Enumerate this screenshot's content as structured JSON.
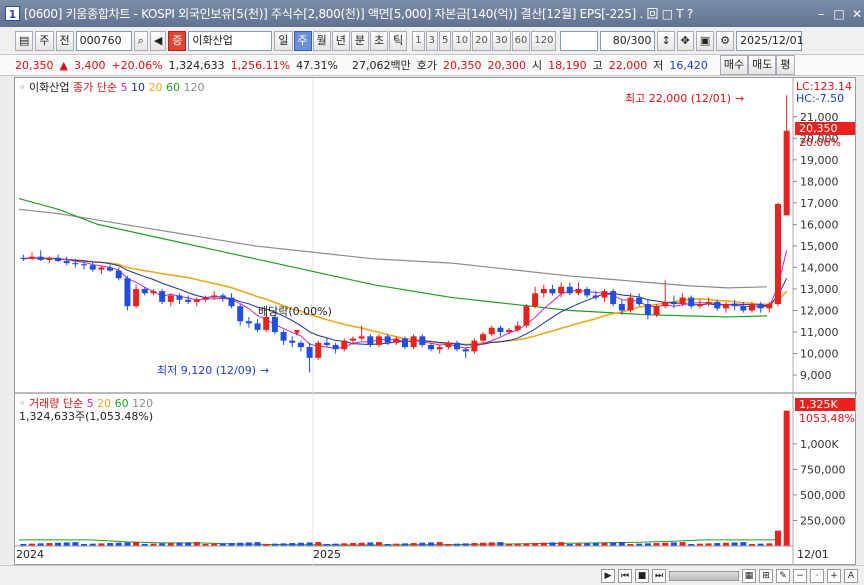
{
  "window": {
    "number": "1",
    "title": "[0600] 키움종합차트 - KOSPI 외국인보유[5(천)] 주식수[2,800(천)] 액면[5,000] 자본금[140(억)] 결산[12월] EPS[-225] . 回 □ T ?"
  },
  "toolbar": {
    "period_type": "주",
    "prev_label": "전",
    "code": "000760",
    "badge": "증",
    "stock_name": "이화산업",
    "tabs": [
      "일",
      "주",
      "월",
      "년",
      "분",
      "초",
      "틱"
    ],
    "selected_tab": "주",
    "intervals": [
      "1",
      "3",
      "5",
      "10",
      "20",
      "30",
      "60",
      "120"
    ],
    "count": "80/300",
    "date": "2025/12/01"
  },
  "quote": {
    "price": "20,350",
    "arrow": "▲",
    "change": "3,400",
    "rate": "+20.06%",
    "volume": "1,324,633",
    "vol_rate": "1,256.11%",
    "turnover": "47.31%",
    "amount": "27,062백만",
    "ask_label": "호가",
    "ask": "20,350",
    "bid": "20,300",
    "open_label": "시",
    "open": "18,190",
    "high_label": "고",
    "high": "22,000",
    "low_label": "저",
    "low": "16,420",
    "sell_label": "매수",
    "buy_label": "매도",
    "flat_label": "평"
  },
  "price_panel": {
    "name": "이화산업",
    "legend_label": "종가 단순",
    "ma": [
      "5",
      "10",
      "20",
      "60",
      "120"
    ],
    "lc": "LC:123.14",
    "hc": "HC:-7.50",
    "current": "20,350",
    "current_pct": "20.06%",
    "high_note": "최고 22,000 (12/01)",
    "low_note": "최저 9,120 (12/09)",
    "dividend": "배당락(0.00%)",
    "y_ticks": [
      "21,000",
      "20,000",
      "19,000",
      "18,000",
      "17,000",
      "16,000",
      "15,000",
      "14,000",
      "13,000",
      "12,000",
      "11,000",
      "10,000",
      "9,000"
    ]
  },
  "volume_panel": {
    "legend_label": "거래량 단순",
    "ma": [
      "5",
      "20",
      "60",
      "120"
    ],
    "value": "1,324,633주(1,053.48%)",
    "current": "1,325K",
    "current_pct": "1053.48%",
    "y_ticks": [
      "1,000K",
      "750,000",
      "500,000",
      "250,000"
    ]
  },
  "x_axis": {
    "labels": [
      "2024",
      "2025",
      "12/01"
    ]
  },
  "colors": {
    "up": "#e8221e",
    "down": "#1f4fe0",
    "ma5": "#d020d0",
    "ma10": "#1a2f9a",
    "ma20": "#f0a818",
    "ma60": "#1ea020",
    "ma120": "#8c8c8c"
  },
  "chart_data": {
    "type": "candlestick",
    "start": "2024-01",
    "freq": "weekly",
    "candles": [
      [
        14450,
        14600,
        14300,
        14400
      ],
      [
        14400,
        14700,
        14350,
        14500
      ],
      [
        14500,
        14800,
        14300,
        14350
      ],
      [
        14350,
        14500,
        14200,
        14450
      ],
      [
        14450,
        14600,
        14250,
        14300
      ],
      [
        14300,
        14500,
        14100,
        14200
      ],
      [
        14200,
        14400,
        14000,
        14150
      ],
      [
        14150,
        14300,
        13900,
        14100
      ],
      [
        14100,
        14250,
        13800,
        13900
      ],
      [
        13900,
        14100,
        13700,
        14000
      ],
      [
        14000,
        14200,
        13800,
        13850
      ],
      [
        13850,
        14000,
        13400,
        13500
      ],
      [
        13500,
        13600,
        12000,
        12200
      ],
      [
        12200,
        13200,
        12100,
        13000
      ],
      [
        13000,
        13100,
        12700,
        12800
      ],
      [
        12800,
        13000,
        12700,
        12900
      ],
      [
        12900,
        13000,
        12300,
        12400
      ],
      [
        12400,
        12800,
        12200,
        12700
      ],
      [
        12700,
        12800,
        12300,
        12500
      ],
      [
        12500,
        12700,
        12300,
        12400
      ],
      [
        12400,
        12600,
        12200,
        12500
      ],
      [
        12500,
        12700,
        12400,
        12600
      ],
      [
        12600,
        12900,
        12500,
        12700
      ],
      [
        12700,
        12800,
        12400,
        12600
      ],
      [
        12600,
        12800,
        12100,
        12200
      ],
      [
        12200,
        12300,
        11300,
        11500
      ],
      [
        11500,
        11700,
        11200,
        11400
      ],
      [
        11400,
        11600,
        11000,
        11100
      ],
      [
        11100,
        11900,
        11000,
        11700
      ],
      [
        11700,
        11800,
        10900,
        11000
      ],
      [
        11000,
        11100,
        10400,
        10600
      ],
      [
        10600,
        10800,
        10300,
        10500
      ],
      [
        10500,
        10600,
        10100,
        10300
      ],
      [
        10300,
        10500,
        9120,
        9800
      ],
      [
        9800,
        10600,
        9700,
        10500
      ],
      [
        10500,
        10700,
        10300,
        10400
      ],
      [
        10400,
        10500,
        10000,
        10200
      ],
      [
        10200,
        10700,
        10100,
        10600
      ],
      [
        10600,
        10800,
        10400,
        10700
      ],
      [
        10700,
        11300,
        10600,
        10800
      ],
      [
        10800,
        10900,
        10300,
        10400
      ],
      [
        10400,
        10900,
        10300,
        10800
      ],
      [
        10800,
        10900,
        10400,
        10500
      ],
      [
        10500,
        10800,
        10400,
        10700
      ],
      [
        10700,
        10800,
        10200,
        10300
      ],
      [
        10300,
        10900,
        10200,
        10800
      ],
      [
        10800,
        10900,
        10300,
        10400
      ],
      [
        10400,
        10500,
        10100,
        10200
      ],
      [
        10200,
        10400,
        10000,
        10300
      ],
      [
        10300,
        10600,
        10200,
        10500
      ],
      [
        10500,
        10600,
        10100,
        10200
      ],
      [
        10200,
        10300,
        9800,
        10100
      ],
      [
        10100,
        10700,
        10000,
        10600
      ],
      [
        10600,
        11000,
        10500,
        10900
      ],
      [
        10900,
        11300,
        10800,
        11200
      ],
      [
        11200,
        11300,
        10800,
        11000
      ],
      [
        11000,
        11200,
        10900,
        11100
      ],
      [
        11100,
        11500,
        11000,
        11300
      ],
      [
        11300,
        12300,
        11200,
        12200
      ],
      [
        12200,
        13100,
        12100,
        12800
      ],
      [
        12800,
        13200,
        12600,
        13000
      ],
      [
        13000,
        13200,
        12700,
        12800
      ],
      [
        12800,
        13300,
        12600,
        13100
      ],
      [
        13100,
        13300,
        12700,
        12800
      ],
      [
        12800,
        13300,
        12700,
        13000
      ],
      [
        13000,
        13100,
        12600,
        12700
      ],
      [
        12700,
        12900,
        12500,
        12600
      ],
      [
        12600,
        13000,
        12400,
        12900
      ],
      [
        12900,
        13000,
        12200,
        12300
      ],
      [
        12300,
        12500,
        11800,
        12000
      ],
      [
        12000,
        12800,
        11900,
        12600
      ],
      [
        12600,
        12800,
        12200,
        12300
      ],
      [
        12300,
        12500,
        11600,
        11800
      ],
      [
        11800,
        12300,
        11700,
        12200
      ],
      [
        12200,
        13400,
        12100,
        12400
      ],
      [
        12400,
        12700,
        12100,
        12300
      ],
      [
        12300,
        12800,
        12200,
        12600
      ],
      [
        12600,
        12700,
        12100,
        12200
      ],
      [
        12200,
        12500,
        12100,
        12300
      ],
      [
        12300,
        12600,
        12200,
        12400
      ],
      [
        12400,
        12500,
        12000,
        12100
      ],
      [
        12100,
        12400,
        11900,
        12300
      ],
      [
        12300,
        12500,
        12000,
        12200
      ],
      [
        12200,
        12400,
        11900,
        12000
      ],
      [
        12000,
        12400,
        11900,
        12300
      ],
      [
        12300,
        12400,
        11900,
        12100
      ],
      [
        12100,
        12400,
        11900,
        12300
      ],
      [
        12300,
        17000,
        12200,
        16950
      ],
      [
        16420,
        22000,
        16420,
        20350
      ]
    ],
    "ma60": [
      17200,
      16700,
      16000,
      15600,
      15200,
      14800,
      14400,
      14000,
      13600,
      13200,
      12900,
      12600,
      12400,
      12200,
      12000,
      11900,
      11800,
      11750,
      11700,
      11750
    ],
    "ma120": [
      16700,
      16500,
      16200,
      15900,
      15600,
      15300,
      15000,
      14800,
      14600,
      14400,
      14300,
      14200,
      14000,
      13800,
      13600,
      13450,
      13300,
      13150,
      13050,
      13100
    ],
    "volume": [
      170000,
      90000,
      70000,
      40000,
      30000,
      30000,
      20000,
      15000,
      12000,
      10000,
      10000,
      12000,
      14000,
      18000,
      22000,
      26000,
      30000,
      35000,
      45000,
      60000,
      75000,
      1324633
    ]
  }
}
